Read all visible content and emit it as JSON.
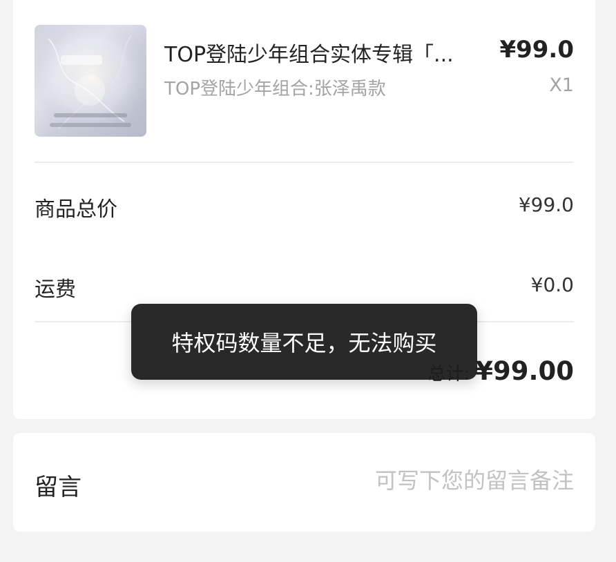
{
  "order": {
    "product": {
      "title": "TOP登陆少年组合实体专辑「...",
      "variant": "TOP登陆少年组合:张泽禹款",
      "price": "¥99.0",
      "quantity": "X1",
      "thumbnail_icon": "album-cover-image"
    },
    "summary": {
      "goods_total_label": "商品总价",
      "goods_total_value": "¥99.0",
      "shipping_label": "运费",
      "shipping_value": "¥0.0",
      "total_label": "总计:",
      "total_value": "¥99.00"
    }
  },
  "message": {
    "label": "留言",
    "placeholder": "可写下您的留言备注"
  },
  "toast": {
    "text": "特权码数量不足，无法购买"
  }
}
